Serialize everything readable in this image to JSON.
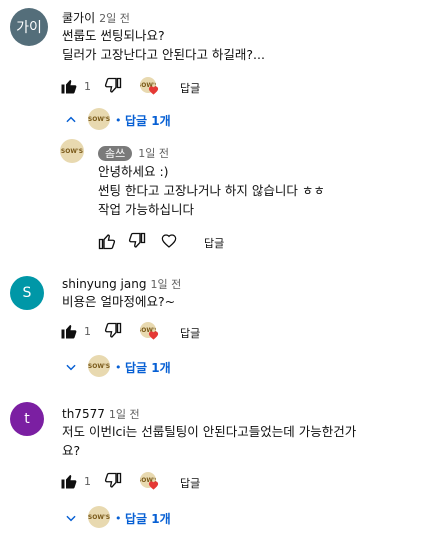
{
  "comments": [
    {
      "avatar_text": "가이",
      "avatar_color": "#546e7a",
      "author": "쿨가이",
      "time": "2일 전",
      "lines": [
        "썬룹도 썬팅되나요?",
        "딜러가 고장난다고 안된다고 하길래?..."
      ],
      "likes": "1",
      "reply_label": "답글",
      "replies_label": "답글 1개",
      "reply": {
        "author_chip": "솜쓰",
        "time": "1일 전",
        "lines": [
          "안녕하세요 :)",
          "썬팅 한다고 고장나거나 하지 않습니다 ㅎㅎ",
          "작업 가능하십니다"
        ],
        "reply_label": "답글"
      }
    },
    {
      "avatar_text": "S",
      "avatar_color": "#0097a7",
      "author": "shinyung jang",
      "time": "1일 전",
      "lines": [
        "비용은 얼마정에요?~"
      ],
      "likes": "1",
      "reply_label": "답글",
      "replies_label": "답글 1개"
    },
    {
      "avatar_text": "t",
      "avatar_color": "#7b1fa2",
      "author": "th7577",
      "time": "1일 전",
      "lines": [
        "저도 이번lci는 선룹틸팅이 안된다고들었는데 가능한건가",
        "요?"
      ],
      "likes": "1",
      "reply_label": "답글",
      "replies_label": "답글 1개"
    }
  ],
  "channel_logo_text": "SOW'S",
  "accent_color": "#065fd4",
  "heart_color": "#e53935"
}
